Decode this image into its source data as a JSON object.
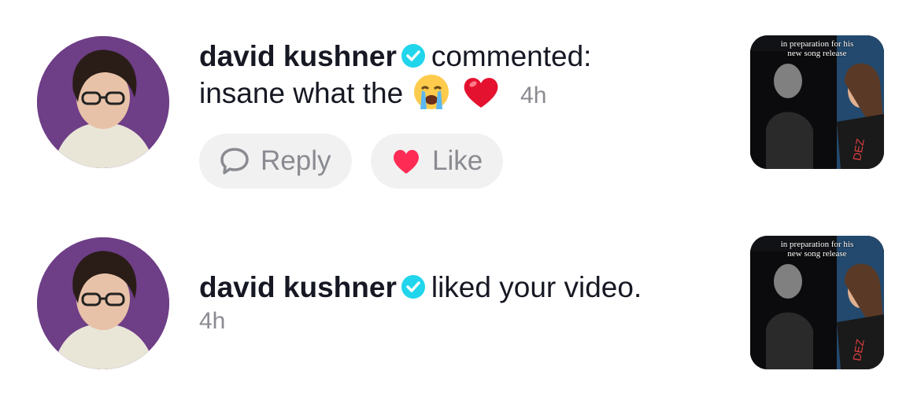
{
  "notifications": [
    {
      "user": "david kushner",
      "action": "commented:",
      "comment": "insane what the",
      "time": "4h",
      "buttons": {
        "reply": "Reply",
        "like": "Like"
      },
      "thumbnail_caption": "in preparation for his new song release"
    },
    {
      "user": "david kushner",
      "action": "liked your video.",
      "time": "4h",
      "thumbnail_caption": "in preparation for his new song release"
    }
  ],
  "icons": {
    "verified": "verified-badge-icon",
    "crying_emoji": "loudly-crying-face-emoji",
    "heart_emoji": "red-heart-emoji",
    "reply": "speech-bubble-icon",
    "like": "heart-icon"
  },
  "colors": {
    "verified": "#20d5ec",
    "like_heart": "#fe2c55",
    "secondary_text": "#8a8b91",
    "button_bg": "#f1f1f2"
  }
}
